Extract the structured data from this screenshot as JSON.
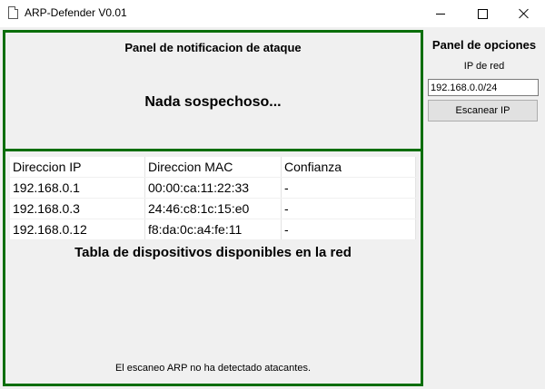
{
  "window": {
    "title": "ARP-Defender V0.01"
  },
  "notification_panel": {
    "title": "Panel de notificacion de ataque",
    "status": "Nada sospechoso..."
  },
  "device_table": {
    "headers": [
      "Direccion IP",
      "Direccion MAC",
      "Confianza"
    ],
    "rows": [
      [
        "192.168.0.1",
        "00:00:ca:11:22:33",
        "-"
      ],
      [
        "192.168.0.3",
        "24:46:c8:1c:15:e0",
        "-"
      ],
      [
        "192.168.0.12",
        "f8:da:0c:a4:fe:11",
        "-"
      ]
    ],
    "caption": "Tabla de dispositivos disponibles en la red",
    "scan_status": "El escaneo ARP no ha detectado atacantes."
  },
  "options_panel": {
    "title": "Panel de opciones",
    "ip_label": "IP de red",
    "ip_value": "192.168.0.0/24",
    "scan_button_label": "Escanear IP"
  },
  "colors": {
    "frame_border": "#0a6e0a",
    "panel_background": "#f0f0f0"
  },
  "icons": {
    "app": "document-icon",
    "minimize": "minimize-icon",
    "maximize": "maximize-icon",
    "close": "close-icon"
  }
}
